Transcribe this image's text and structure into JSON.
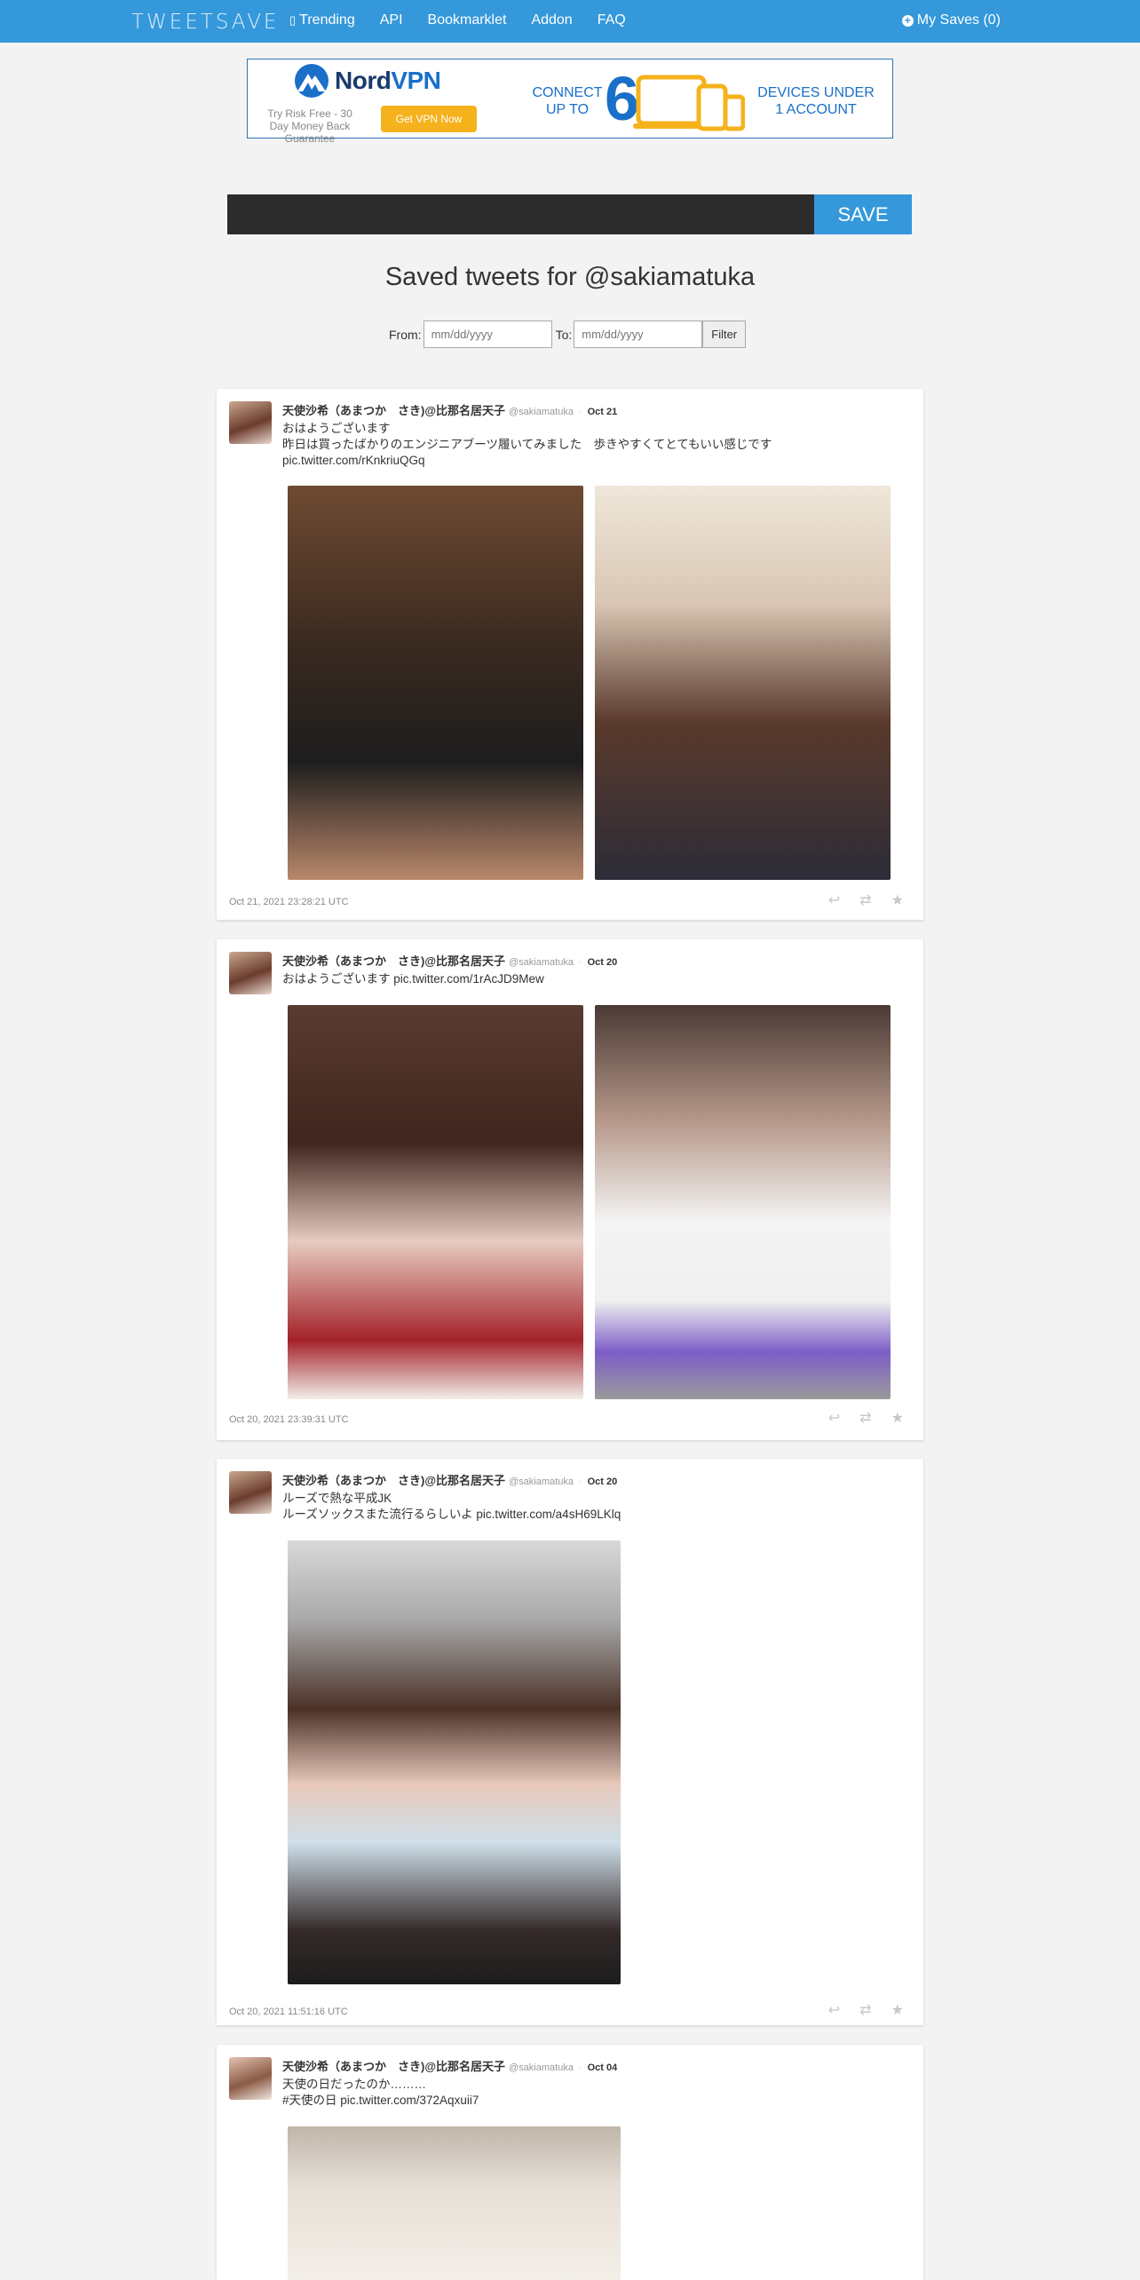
{
  "nav": {
    "brand": "TWEETSAVE",
    "links": [
      {
        "label": "Trending",
        "icon": "fire-icon"
      },
      {
        "label": "API"
      },
      {
        "label": "Bookmarklet"
      },
      {
        "label": "Addon"
      },
      {
        "label": "FAQ"
      }
    ],
    "my_saves": "My Saves (0)"
  },
  "ad": {
    "logo_nord": "Nord",
    "logo_vpn": "VPN",
    "subtext": "Try Risk Free - 30 Day Money Back Guarantee",
    "button": "Get VPN Now",
    "connect": "CONNECT UP TO",
    "number": "6",
    "devices": "DEVICES UNDER 1 ACCOUNT"
  },
  "save_form": {
    "input_value": "",
    "button": "SAVE"
  },
  "title": "Saved tweets for @sakiamatuka",
  "filter": {
    "from_label": "From:",
    "from_placeholder": "mm/dd/yyyy",
    "to_label": "To:",
    "to_placeholder": "mm/dd/yyyy",
    "button": "Filter"
  },
  "tweets": [
    {
      "name": "天使沙希（あまつか　さき)@比那名居天子",
      "handle": "@sakiamatuka",
      "date": "Oct 21",
      "text": "おはようございます\n昨日は買ったばかりのエンジニアブーツ履いてみました　歩きやすくてとてもいい感じです\npic.twitter.com/rKnkriuQGq",
      "timestamp": "Oct 21, 2021 23:28:21 UTC"
    },
    {
      "name": "天使沙希（あまつか　さき)@比那名居天子",
      "handle": "@sakiamatuka",
      "date": "Oct 20",
      "text": "おはようございます pic.twitter.com/1rAcJD9Mew",
      "timestamp": "Oct 20, 2021 23:39:31 UTC"
    },
    {
      "name": "天使沙希（あまつか　さき)@比那名居天子",
      "handle": "@sakiamatuka",
      "date": "Oct 20",
      "text": "ルーズで熱な平成JK\nルーズソックスまた流行るらしいよ pic.twitter.com/a4sH69LKlq",
      "timestamp": "Oct 20, 2021 11:51:16 UTC"
    },
    {
      "name": "天使沙希（あまつか　さき)@比那名居天子",
      "handle": "@sakiamatuka",
      "date": "Oct 04",
      "text": "天使の日だったのか………\n#天使の日 pic.twitter.com/372Aqxuii7",
      "timestamp": ""
    }
  ],
  "actions": {
    "reply": "reply-icon",
    "retweet": "retweet-icon",
    "favorite": "star-icon"
  }
}
